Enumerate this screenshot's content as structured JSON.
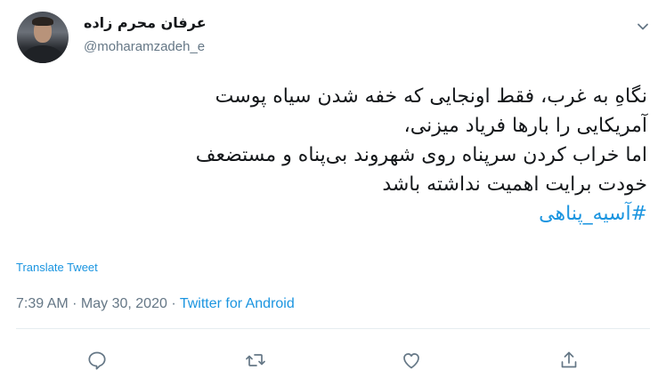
{
  "author": {
    "name": "عرفان محرم زاده",
    "handle": "@moharamzadeh_e"
  },
  "tweet": {
    "lines": [
      "نگاهِ به غرب، فقط اونجایی که خفه شدن سیاه پوست",
      "آمریکایی را بارها فریاد میزنی،",
      "اما خراب کردن سرپناه روی شهروند بی‌پناه و مستضعف",
      "خودت برایت اهمیت نداشته باشد"
    ],
    "hashtag": "#آسیه_پناهی"
  },
  "translate_label": "Translate Tweet",
  "meta": {
    "time": "7:39 AM",
    "separator": " · ",
    "date": "May 30, 2020",
    "source": "Twitter for Android"
  },
  "colors": {
    "link": "#1b95e0",
    "secondary_text": "#657786",
    "divider": "#e6ecf0"
  },
  "icons": {
    "menu": "chevron-down-icon",
    "reply": "reply-icon",
    "retweet": "retweet-icon",
    "like": "heart-icon",
    "share": "share-icon"
  }
}
